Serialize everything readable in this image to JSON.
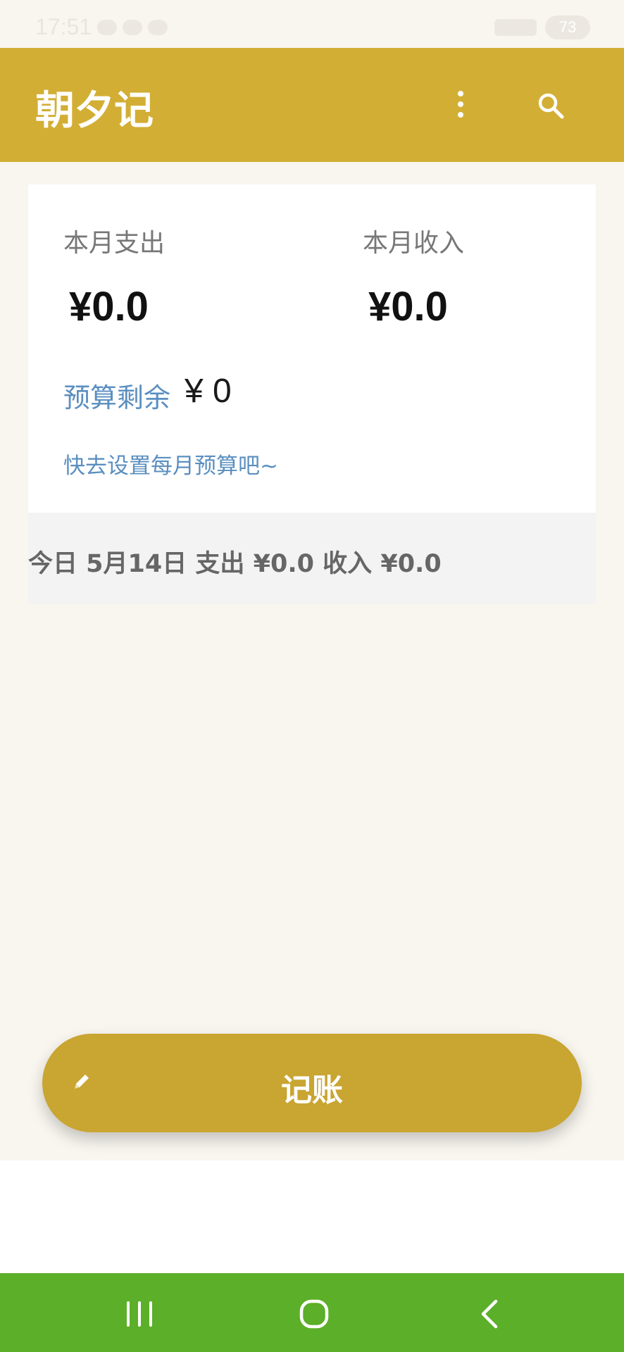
{
  "status_bar": {
    "time": "17:51",
    "battery": "73"
  },
  "app_bar": {
    "title": "朝夕记",
    "icons": [
      "more-vertical-icon",
      "search-icon"
    ]
  },
  "summary": {
    "expense_label": "本月支出",
    "expense_value": "¥0.0",
    "income_label": "本月收入",
    "income_value": "¥0.0",
    "budget_label": "预算剩余",
    "budget_value": "¥ 0",
    "budget_hint": "快去设置每月预算吧~"
  },
  "today": {
    "text": "今日 5月14日 支出 ¥0.0  收入 ¥0.0"
  },
  "record_button": {
    "label": "记账",
    "icon": "pencil-icon"
  },
  "nav_bar": {
    "icons": [
      "recents-icon",
      "home-icon",
      "back-icon"
    ]
  },
  "colors": {
    "app_bar": "#d2ae34",
    "record_button": "#c9a531",
    "nav_bar": "#5caf28",
    "link": "#5b8fc0",
    "background": "#f9f6f0"
  }
}
